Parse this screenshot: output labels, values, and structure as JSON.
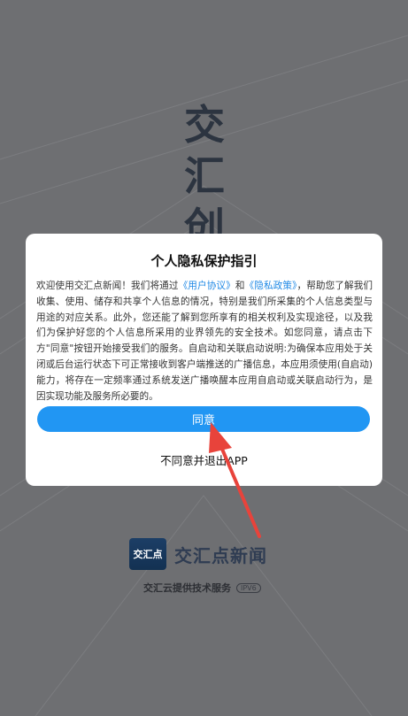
{
  "splash": {
    "title_chars": [
      "交",
      "汇",
      "创"
    ],
    "logo_mark": "交汇点",
    "brand_name": "交汇点新闻",
    "tech_service": "交汇云提供技术服务",
    "ipv6_badge": "IPV6"
  },
  "dialog": {
    "title": "个人隐私保护指引",
    "body": {
      "part1": "欢迎使用交汇点新闻！我们将通过",
      "link_user_agreement": "《用户协议》",
      "part2": "和",
      "link_privacy_policy": "《隐私政策》",
      "part3": "，帮助您了解我们收集、使用、储存和共享个人信息的情况，特别是我们所采集的个人信息类型与用途的对应关系。此外，您还能了解到您所享有的相关权利及实现途径，以及我们为保护好您的个人信息所采用的业界领先的安全技术。如您同意，请点击下方\"同意\"按钮开始接受我们的服务。自启动和关联启动说明:为确保本应用处于关闭或后台运行状态下可正常接收到客户端推送的广播信息，本应用须使用(自启动)能力，将存在一定频率通过系统发送广播唤醒本应用自启动或关联启动行为，是因实现功能及服务所必要的。"
    },
    "agree_button": "同意",
    "disagree_link": "不同意并退出APP"
  },
  "colors": {
    "overlay_bg": "#6e6f72",
    "accent": "#2196f3",
    "link": "#1e88e5",
    "annotation_arrow": "#e8433b"
  }
}
